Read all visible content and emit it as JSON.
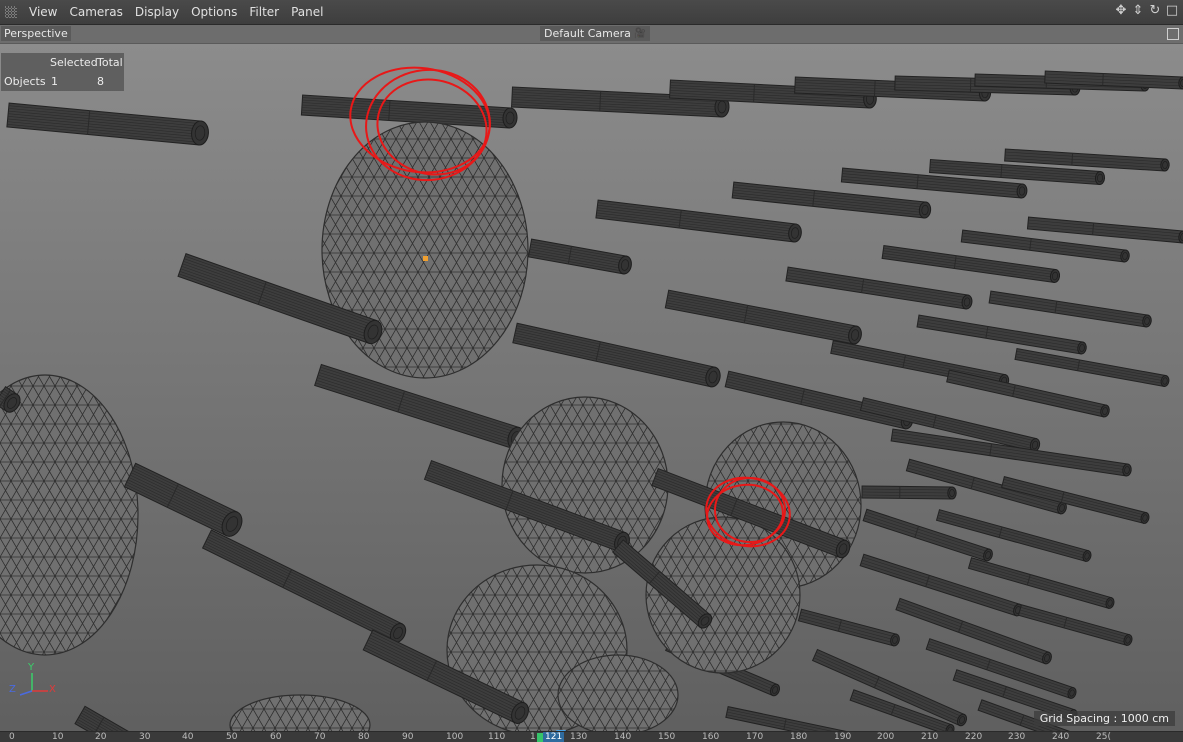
{
  "menu": {
    "items": [
      "View",
      "Cameras",
      "Display",
      "Options",
      "Filter",
      "Panel"
    ]
  },
  "viewport": {
    "name": "Perspective",
    "camera": "Default Camera",
    "hud": {
      "col_selected": "Selected",
      "col_total": "Total",
      "row_label": "Objects",
      "selected": "1",
      "total": "8"
    },
    "grid_spacing": "Grid Spacing : 1000 cm",
    "axis": {
      "y": "Y",
      "x": "X",
      "z": "Z"
    }
  },
  "timeline": {
    "ticks": [
      "0",
      "10",
      "20",
      "30",
      "40",
      "50",
      "60",
      "70",
      "80",
      "90",
      "100",
      "110",
      "1",
      "130",
      "140",
      "150",
      "160",
      "170",
      "180",
      "190",
      "200",
      "210",
      "220",
      "230",
      "240",
      "25("
    ],
    "current_frame": "121"
  },
  "colors": {
    "annotation": "#e81818",
    "selection_dot": "#f0a030",
    "playhead": "#4aa0e0"
  }
}
